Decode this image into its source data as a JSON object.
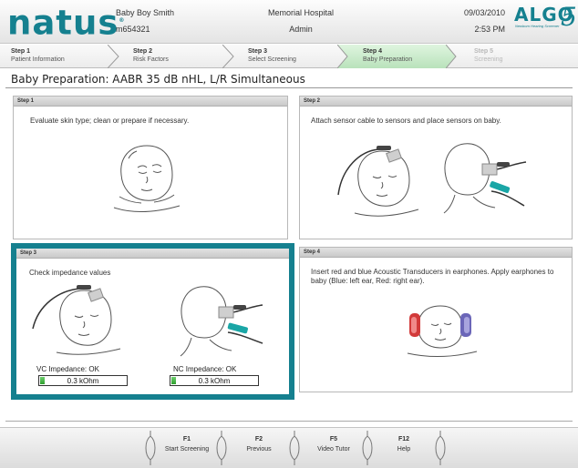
{
  "header": {
    "brand": "natus",
    "patient_name": "Baby Boy Smith",
    "patient_id": "m654321",
    "hospital": "Memorial Hospital",
    "user": "Admin",
    "date": "09/03/2010",
    "time": "2:53 PM",
    "product_logo": {
      "word": "ALGO",
      "version": "5",
      "tagline": "Newborn Hearing Screener"
    }
  },
  "steps": [
    {
      "step": "Step 1",
      "label": "Patient Information",
      "state": "done"
    },
    {
      "step": "Step 2",
      "label": "Risk Factors",
      "state": "done"
    },
    {
      "step": "Step 3",
      "label": "Select Screening",
      "state": "done"
    },
    {
      "step": "Step 4",
      "label": "Baby Preparation",
      "state": "active"
    },
    {
      "step": "Step 5",
      "label": "Screening",
      "state": "disabled"
    }
  ],
  "page_title": "Baby Preparation: AABR 35 dB nHL, L/R Simultaneous",
  "panels": [
    {
      "header": "Step 1",
      "instruction": "Evaluate skin type; clean or prepare if necessary."
    },
    {
      "header": "Step 2",
      "instruction": "Attach sensor cable to sensors and place sensors on baby."
    },
    {
      "header": "Step 3",
      "instruction": "Check impedance values",
      "impedance": [
        {
          "label": "VC Impedance:  OK",
          "value": "0.3 kOhm",
          "level": 0.05
        },
        {
          "label": "NC Impedance:  OK",
          "value": "0.3 kOhm",
          "level": 0.05
        }
      ]
    },
    {
      "header": "Step 4",
      "instruction": "Insert red and blue Acoustic Transducers in earphones. Apply earphones to baby (Blue: left ear, Red: right ear)."
    }
  ],
  "function_keys": [
    {
      "key": "F1",
      "label": "Start Screening"
    },
    {
      "key": "F2",
      "label": "Previous"
    },
    {
      "key": "F5",
      "label": "Video Tutor"
    },
    {
      "key": "F12",
      "label": "Help"
    }
  ],
  "colors": {
    "brand_teal": "#15808f",
    "active_step": "#b9e2bb",
    "impedance_ok": "#2f9f2f",
    "cable_teal": "#1aa6a6",
    "earphone_red": "#d23a3a",
    "earphone_blue": "#6b66b8"
  },
  "icons": [
    "baby-face-illustration",
    "baby-head-back-illustration",
    "sensor-cable-illustration",
    "earphones-illustration"
  ]
}
